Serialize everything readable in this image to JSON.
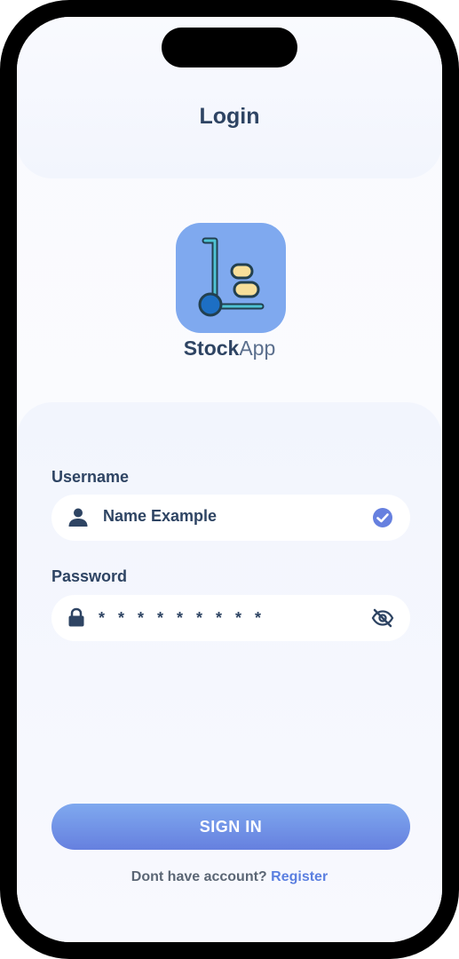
{
  "header": {
    "title": "Login"
  },
  "brand": {
    "name_strong": "Stock",
    "name_light": "App",
    "logo_icon": "hand-truck-icon"
  },
  "form": {
    "username": {
      "label": "Username",
      "value": "Name Example",
      "lead_icon": "person-icon",
      "trail_icon": "check-circle-icon"
    },
    "password": {
      "label": "Password",
      "value": "* * * * * * * * *",
      "lead_icon": "lock-icon",
      "trail_icon": "eye-off-icon"
    }
  },
  "actions": {
    "signin_label": "SIGN IN"
  },
  "footer": {
    "prompt": "Dont have account?",
    "link": "Register"
  },
  "colors": {
    "accent": "#6680df",
    "accent_light": "#7fa9ef",
    "text_dark": "#2e4463",
    "link": "#5b7fe0",
    "logo_bg": "#7fa9ef"
  }
}
